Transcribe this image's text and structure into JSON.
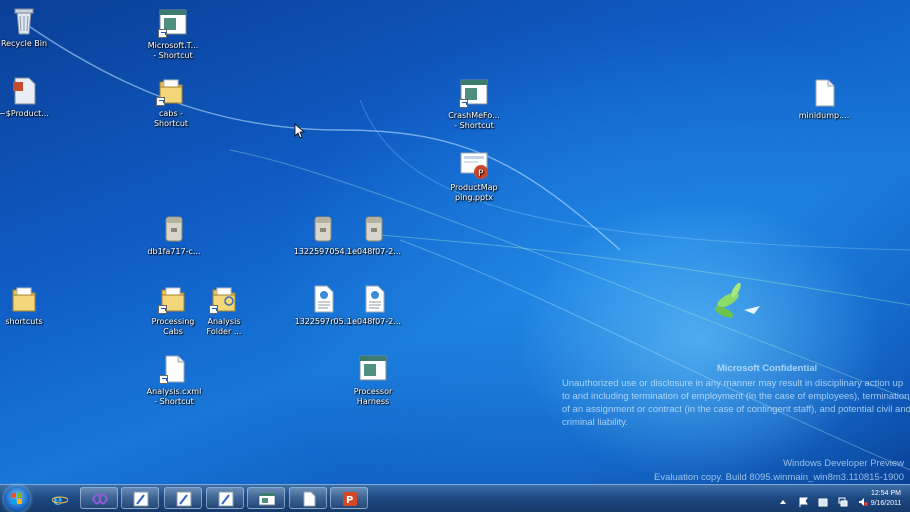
{
  "desktop": {
    "icons": [
      {
        "label": "Recycle Bin",
        "icon": "recycle-bin-icon"
      },
      {
        "label": "Microsoft.T...\n- Shortcut",
        "icon": "app-window-icon"
      },
      {
        "label": "~$Product...",
        "icon": "document-icon"
      },
      {
        "label": "cabs -\nShortcut",
        "icon": "folder-icon"
      },
      {
        "label": "CrashMeFo...\n- Shortcut",
        "icon": "app-window-icon"
      },
      {
        "label": "minidump....",
        "icon": "blank-file-icon"
      },
      {
        "label": "ProductMap\nping.pptx",
        "icon": "powerpoint-file-icon"
      },
      {
        "label": "db1fa717-c...",
        "icon": "cab-file-icon"
      },
      {
        "label": "1322597054...",
        "icon": "cab-file-icon"
      },
      {
        "label": "1e048f07-2...",
        "icon": "cab-file-icon"
      },
      {
        "label": "shortcuts",
        "icon": "folder-icon"
      },
      {
        "label": "Processing\nCabs",
        "icon": "folder-icon"
      },
      {
        "label": "Analysis\nFolder ...",
        "icon": "folder-icon"
      },
      {
        "label": "1322597r05...",
        "icon": "xml-file-icon"
      },
      {
        "label": "1e048f07-2...",
        "icon": "xml-file-icon"
      },
      {
        "label": "Analysis.cxml\n- Shortcut",
        "icon": "blank-file-icon"
      },
      {
        "label": "Processor\nHarness",
        "icon": "app-window-icon"
      }
    ],
    "confidential": {
      "title": "Microsoft Confidential",
      "body": "Unauthorized use or disclosure in any manner may result in disciplinary action up to and including termination of employment (in the case of employees), termination of an assignment or contract (in the case of contingent staff), and potential civil and criminal liability."
    },
    "watermark": {
      "edition": "Windows Developer Preview",
      "build": "Evaluation copy. Build 8095.winmain_win8m3.110815-1900"
    }
  },
  "taskbar": {
    "start_icon": "windows-flag-icon",
    "buttons": [
      {
        "icon": "internet-explorer-icon"
      },
      {
        "icon": "visual-studio-icon"
      },
      {
        "icon": "paint-brush-icon"
      },
      {
        "icon": "paint-brush-icon"
      },
      {
        "icon": "paint-brush-icon"
      },
      {
        "icon": "app-window-icon"
      },
      {
        "icon": "blank-file-icon"
      },
      {
        "icon": "powerpoint-icon"
      }
    ],
    "tray_icons": [
      "chevron-up-icon",
      "flag-icon",
      "device-icon",
      "network-icon",
      "volume-icon"
    ],
    "clock": {
      "time": "12:54 PM",
      "date": "9/16/2011"
    }
  },
  "colors": {
    "accent": "#1877d8",
    "taskbar": "#1d4a82"
  }
}
